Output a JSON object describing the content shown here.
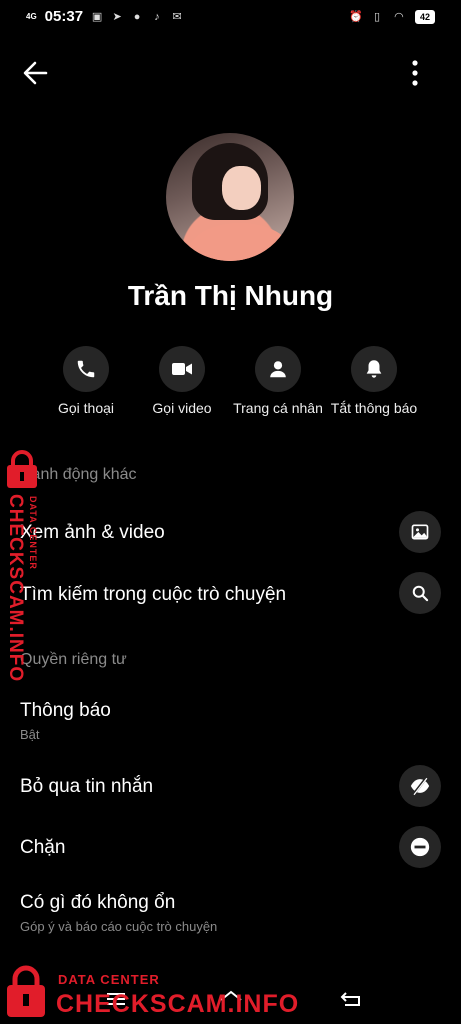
{
  "status_bar": {
    "network": "4G",
    "time": "05:37",
    "battery": "42"
  },
  "header": {
    "back_icon": "arrow-left-icon",
    "more_icon": "more-vertical-icon"
  },
  "profile": {
    "name": "Trần Thị Nhung"
  },
  "actions": [
    {
      "label": "Gọi thoại",
      "icon": "phone-icon"
    },
    {
      "label": "Gọi video",
      "icon": "video-icon"
    },
    {
      "label": "Trang cá nhân",
      "icon": "person-icon"
    },
    {
      "label": "Tắt thông báo",
      "icon": "bell-icon"
    }
  ],
  "sections": {
    "other_actions": "Hành động khác",
    "privacy": "Quyền riêng tư"
  },
  "other_actions_items": [
    {
      "label": "Xem ảnh & video",
      "icon": "image-icon"
    },
    {
      "label": "Tìm kiếm trong cuộc trò chuyện",
      "icon": "search-icon"
    }
  ],
  "privacy_items": {
    "notifications": {
      "label": "Thông báo",
      "sub": "Bật"
    },
    "ignore": {
      "label": "Bỏ qua tin nhắn",
      "icon": "eye-slash-icon"
    },
    "block": {
      "label": "Chặn",
      "icon": "block-icon"
    },
    "report": {
      "label": "Có gì đó không ổn",
      "sub": "Góp ý và báo cáo cuộc trò chuyện"
    }
  },
  "watermark": {
    "top": "DATA CENTER",
    "brand": "CHECKSCAM.INFO"
  },
  "colors": {
    "background": "#000000",
    "circle": "#262626",
    "muted": "#8b8b8b",
    "watermark": "#e11d2a"
  }
}
